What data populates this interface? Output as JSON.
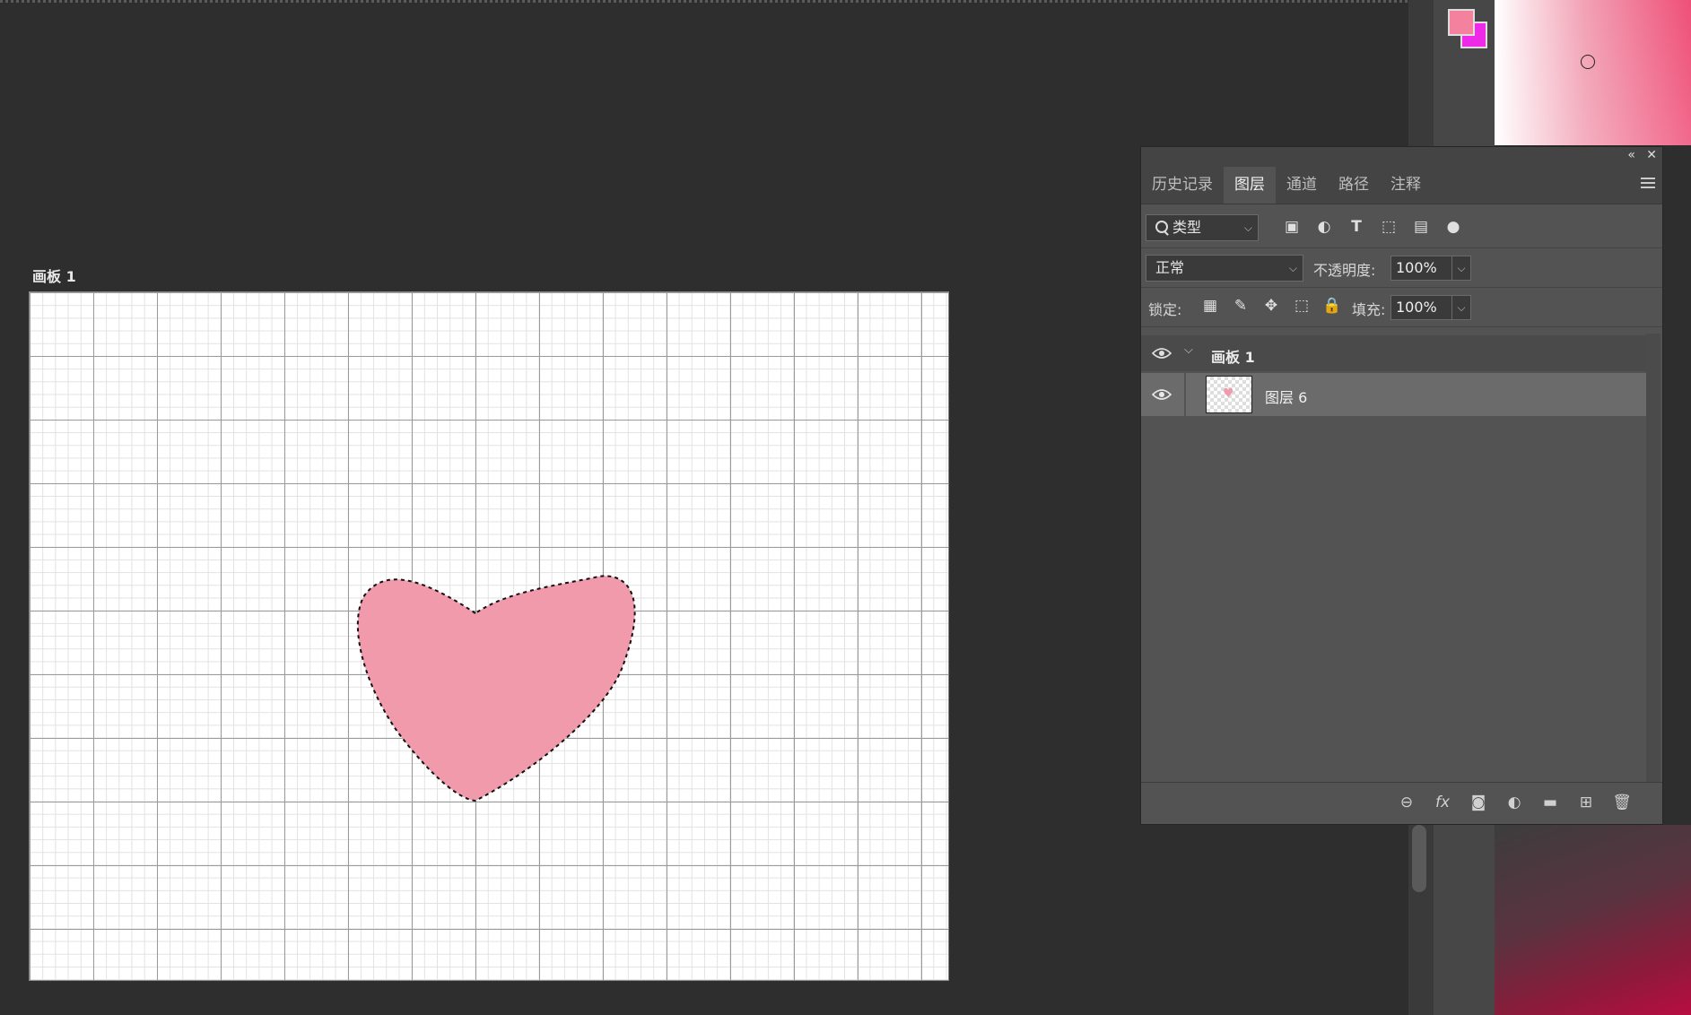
{
  "canvas": {
    "artboard_label": "画板 1",
    "shape_color": "#f19aab",
    "selection": "marching-ants"
  },
  "colors": {
    "foreground": "#f4819e",
    "background": "#ee29e8"
  },
  "layers_panel": {
    "tabs": [
      {
        "label": "历史记录",
        "active": false
      },
      {
        "label": "图层",
        "active": true
      },
      {
        "label": "通道",
        "active": false
      },
      {
        "label": "路径",
        "active": false
      },
      {
        "label": "注释",
        "active": false
      }
    ],
    "filter": {
      "kind_label": "类型",
      "icons": [
        "image-filter-icon",
        "adjustment-filter-icon",
        "type-filter-icon",
        "shape-filter-icon",
        "smart-object-filter-icon",
        "filter-toggle-icon"
      ]
    },
    "blend_mode": "正常",
    "opacity_label": "不透明度:",
    "opacity_value": "100%",
    "lock_label": "锁定:",
    "lock_icons": [
      "lock-transparent-icon",
      "lock-paint-icon",
      "lock-position-icon",
      "lock-artboard-icon",
      "lock-all-icon"
    ],
    "fill_label": "填充:",
    "fill_value": "100%",
    "layers": [
      {
        "name": "画板 1",
        "type": "artboard",
        "visible": true,
        "expanded": true
      },
      {
        "name": "图层 6",
        "type": "pixel",
        "visible": true,
        "selected": true
      }
    ],
    "bottom_icons": [
      "link-icon",
      "fx-icon",
      "mask-icon",
      "adjustment-layer-icon",
      "group-folder-icon",
      "new-layer-icon",
      "trash-icon"
    ]
  }
}
